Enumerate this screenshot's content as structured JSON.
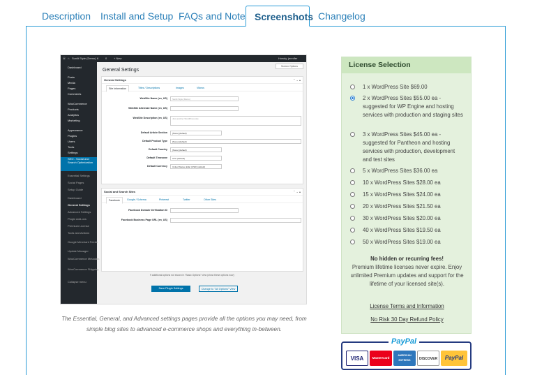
{
  "tabs": [
    {
      "label": "Description"
    },
    {
      "label": "Install and Setup"
    },
    {
      "label": "FAQs and Notes"
    },
    {
      "label": "Screenshots",
      "active": true
    },
    {
      "label": "Changelog"
    }
  ],
  "screenshot": {
    "adminbar": {
      "site": "Sunlit Style (Demo)",
      "comments": "6",
      "new": "0",
      "add": "+ New",
      "user": "Howdy, jennifer"
    },
    "sidebar": [
      "Dashboard",
      "Posts",
      "Media",
      "Pages",
      "Comments",
      "WooCommerce",
      "Products",
      "Analytics",
      "Marketing",
      "Appearance",
      "Plugins",
      "Users",
      "Tools",
      "Settings",
      "SEO - Social and Search Optimization",
      "Essential Settings",
      "Social Pages",
      "Setup Guide",
      "Dashboard",
      "General Settings",
      "Advanced Settings",
      "Plugin Add-ons",
      "Premium License",
      "Tools and Actions",
      "Google Merchant Feeds",
      "Update Manager",
      "WooCommerce Metadata",
      "WooCommerce Shipping",
      "Collapse menu"
    ],
    "page_title": "General Settings",
    "screen_options": "Screen Options",
    "box1": {
      "title": "General Settings",
      "tabs": [
        "Site Information",
        "Titles / Descriptions",
        "Images",
        "Videos"
      ],
      "fields": [
        {
          "label": "WebSite Name (en_US)",
          "value": "Sunlit Style (Demo)"
        },
        {
          "label": "WebSite Alternate Name (en_US)",
          "value": ""
        },
        {
          "label": "WebSite Description (en_US)",
          "value": "Just another WordPress site"
        },
        {
          "label": "Default Article Section",
          "value": "[None] (default)"
        },
        {
          "label": "Default Product Type",
          "value": "[None] (default)"
        },
        {
          "label": "Default Country",
          "value": "[None] (default)"
        },
        {
          "label": "Default Timezone",
          "value": "UTC (default)"
        },
        {
          "label": "Default Currency",
          "value": "United States dollar (USD) (default)"
        }
      ]
    },
    "box2": {
      "title": "Social and Search Sites",
      "tabs": [
        "Facebook",
        "Google / Schema",
        "Pinterest",
        "Twitter",
        "Other Sites"
      ],
      "fields": [
        {
          "label": "Facebook Domain Verification ID",
          "value": ""
        },
        {
          "label": "Facebook Business Page URL (en_US)",
          "value": ""
        }
      ]
    },
    "footnote": "9 additional options not shown in \"Basic Options\" view (show these options now)",
    "save_button": "Save Plugin Settings",
    "change_button": "Change to \"All Options\" View"
  },
  "caption": "The Essential, General, and Advanced settings pages provide all the options you may need, from simple blog sites to advanced e-commerce shops and everything in-between.",
  "license": {
    "title": "License Selection",
    "options": [
      {
        "text": "1 x  WordPress Site $69.00",
        "selected": false
      },
      {
        "text": "2 x  WordPress Sites $55.00 ea - suggested for WP Engine and hosting services with production and staging sites",
        "selected": true
      },
      {
        "text": "3 x  WordPress Sites $45.00 ea - suggested for Pantheon and hosting services with production, development and test sites",
        "selected": false
      },
      {
        "text": "5 x  WordPress Sites $36.00 ea",
        "selected": false
      },
      {
        "text": "10 x  WordPress Sites $28.00 ea",
        "selected": false
      },
      {
        "text": "15 x  WordPress Sites $24.00 ea",
        "selected": false
      },
      {
        "text": "20 x  WordPress Sites $21.50 ea",
        "selected": false
      },
      {
        "text": "30 x  WordPress Sites $20.00 ea",
        "selected": false
      },
      {
        "text": "40 x  WordPress Sites $19.50 ea",
        "selected": false
      },
      {
        "text": "50 x  WordPress Sites $19.00 ea",
        "selected": false
      }
    ],
    "fees_heading": "No hidden or recurring fees!",
    "fees_text": "Premium lifetime licenses never expire. Enjoy unlimited Premium updates and support for the lifetime of your licensed site(s).",
    "terms_link": "License Terms and Information",
    "refund_link": "No Risk 30 Day Refund Policy"
  },
  "paypal": {
    "title": "PayPal",
    "cards": [
      "VISA",
      "MasterCard",
      "AMERICAN EXPRESS",
      "DISCOVER",
      "PayPal"
    ]
  }
}
